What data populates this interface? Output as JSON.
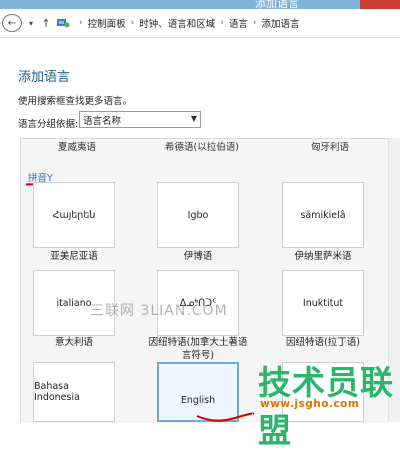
{
  "window": {
    "title": "添加语言"
  },
  "breadcrumb": [
    "控制面板",
    "时钟、语言和区域",
    "语言",
    "添加语言"
  ],
  "page": {
    "title": "添加语言",
    "hint": "使用搜索框查找更多语言。",
    "group_label": "语言分组依据:",
    "group_value": "语言名称"
  },
  "top_names": [
    "夏威夷语",
    "希德语(以拉伯语)",
    "匈牙利语"
  ],
  "section": {
    "header": "拼音Y"
  },
  "tiles": [
    {
      "native": "Հայերեն",
      "name": "亚美尼亚语"
    },
    {
      "native": "Igbo",
      "name": "伊博语"
    },
    {
      "native": "sämikielâ",
      "name": "伊纳里萨米语"
    },
    {
      "native": "italiano",
      "name": "意大利语"
    },
    {
      "native": "ᐃᓄᒃᑎᑐᑦ",
      "name": "因纽特语(加拿大土著语言符号)"
    },
    {
      "native": "Inuktitut",
      "name": "因纽特语(拉丁语)"
    },
    {
      "native": "Bahasa Indonesia",
      "name": ""
    },
    {
      "native": "English",
      "name": ""
    },
    {
      "native": "",
      "name": ""
    }
  ],
  "watermark": "三联网 3LIAN.COM",
  "logo": {
    "text": "技术员联盟",
    "url": "www.jsgho.com"
  },
  "colors": {
    "accent": "#1e5a8e",
    "section": "#2a6ebb",
    "logo": "#2bb56a",
    "url": "#e07000",
    "mark": "#d40000"
  }
}
